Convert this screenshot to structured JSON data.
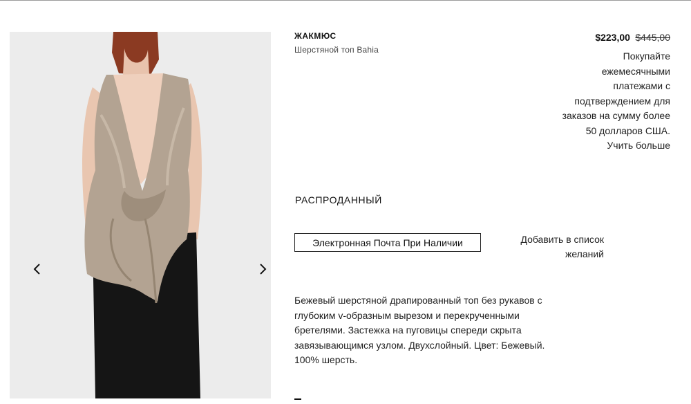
{
  "product": {
    "brand": "ЖАКМЮС",
    "name": "Шерстяной топ Bahia",
    "price_sale": "$223,00",
    "price_original": "$445,00",
    "installments_text": "Покупайте ежемесячными платежами с подтверждением для заказов на сумму более 50 долларов США.",
    "learn_more": "Учить больше",
    "status": "РАСПРОДАННЫЙ",
    "notify_label": "Электронная Почта При Наличии",
    "wishlist_label": "Добавить в список желаний",
    "description": "Бежевый шерстяной драпированный топ без рукавов с глубоким v-образным вырезом и перекрученными бретелями. Застежка на пуговицы спереди скрыта завязывающимся узлом. Двухслойный. Цвет: Бежевый. 100% шерсть."
  },
  "gallery": {
    "prev_icon": "chevron-left-icon",
    "next_icon": "chevron-right-icon",
    "background": "#ececec",
    "top_color": "#b3a392",
    "pants_color": "#151515"
  }
}
